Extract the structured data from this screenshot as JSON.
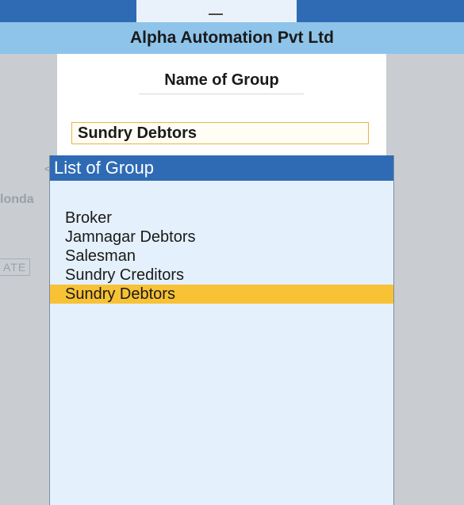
{
  "company": {
    "name": "Alpha Automation Pvt Ltd"
  },
  "form": {
    "title": "Name of Group",
    "value": "Sundry Debtors"
  },
  "background": {
    "fragment_1": "londa",
    "fragment_2": "ATE",
    "fragment_3": "<"
  },
  "list": {
    "title": "List of Group",
    "items": [
      {
        "label": "Broker"
      },
      {
        "label": "Jamnagar Debtors"
      },
      {
        "label": "Salesman"
      },
      {
        "label": "Sundry Creditors"
      },
      {
        "label": "Sundry Debtors"
      }
    ],
    "selected_index": 4
  },
  "colors": {
    "accent_blue": "#2f6bb5",
    "company_bar": "#8fc4ea",
    "selection": "#f8c235",
    "list_bg": "#e4f0fb"
  }
}
